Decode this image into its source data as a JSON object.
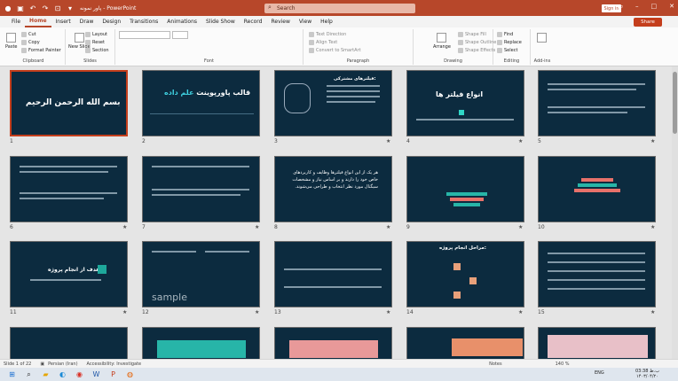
{
  "titlebar": {
    "doc_title": "پاور نمونه - PowerPoint",
    "search_placeholder": "Search",
    "signin": "Sign in"
  },
  "menu": [
    "File",
    "Home",
    "Insert",
    "Draw",
    "Design",
    "Transitions",
    "Animations",
    "Slide Show",
    "Record",
    "Review",
    "View",
    "Help"
  ],
  "share": "Share",
  "ribbon": {
    "clipboard": {
      "label": "Clipboard",
      "paste": "Paste",
      "cut": "Cut",
      "copy": "Copy",
      "format_painter": "Format Painter"
    },
    "slides": {
      "label": "Slides",
      "new_slide": "New Slide",
      "layout": "Layout",
      "reset": "Reset",
      "section": "Section"
    },
    "font": {
      "label": "Font"
    },
    "paragraph": {
      "label": "Paragraph",
      "text_direction": "Text Direction",
      "align_text": "Align Text",
      "convert": "Convert to SmartArt"
    },
    "drawing": {
      "label": "Drawing",
      "arrange": "Arrange",
      "quick_styles": "Quick Styles",
      "shape_fill": "Shape Fill",
      "shape_outline": "Shape Outline",
      "shape_effects": "Shape Effects"
    },
    "editing": {
      "label": "Editing",
      "find": "Find",
      "replace": "Replace",
      "select": "Select"
    },
    "addins": {
      "label": "Add-ins"
    }
  },
  "slides": [
    {
      "n": "1",
      "title": "بسم الله الرحمن الرحیم"
    },
    {
      "n": "2",
      "title": "قالب پاورپوینت",
      "accent": "علم داده"
    },
    {
      "n": "3",
      "title": "فیلترهای مشترکی:"
    },
    {
      "n": "4",
      "title": "انواع فیلتر ها"
    },
    {
      "n": "5",
      "title": ""
    },
    {
      "n": "6",
      "title": ""
    },
    {
      "n": "7",
      "title": ""
    },
    {
      "n": "8",
      "title": "هر یک از این انواع فیلترها وظایف و کاربردهای خاص خود را دارند و بر اساس نیاز و مشخصات سیگنال مورد نظر انتخاب و طراحی می‌شوند."
    },
    {
      "n": "9",
      "title": ""
    },
    {
      "n": "10",
      "title": ""
    },
    {
      "n": "11",
      "title": "هدف از انجام پروژه:"
    },
    {
      "n": "12",
      "title": "",
      "watermark": "sample"
    },
    {
      "n": "13",
      "title": ""
    },
    {
      "n": "14",
      "title": "مراحل انجام پروژه:"
    },
    {
      "n": "15",
      "title": ""
    }
  ],
  "status": {
    "slide_info": "Slide 1 of 22",
    "language": "Persian (Iran)",
    "accessibility": "Accessibility: Investigate",
    "notes": "Notes",
    "zoom": "140 %"
  },
  "taskbar": {
    "time": "03:38 ب.ظ",
    "lang": "ENG",
    "date": "۱۴۰۳/۰۴/۲۰"
  }
}
